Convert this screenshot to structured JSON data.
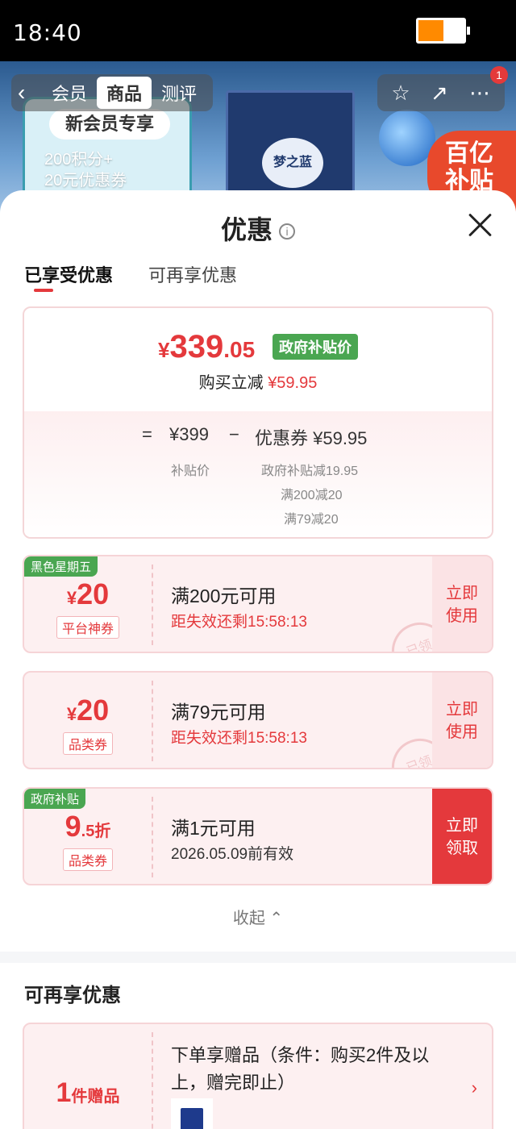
{
  "status_bar": {
    "time": "18:40",
    "battery_percent": 55,
    "battery_color": "#ff8a00"
  },
  "product_header": {
    "tabs": [
      "商品",
      "测评"
    ],
    "back_partial": "会员",
    "member_card": {
      "title": "新会员专享",
      "line1": "200积分+",
      "line2": "20元优惠券"
    },
    "product_logo": "梦之蓝",
    "subsidy_tag": [
      "百亿",
      "补贴"
    ],
    "notification_badge": "1"
  },
  "sheet": {
    "title": "优惠",
    "tabs": {
      "enjoyed": "已享受优惠",
      "available": "可再享优惠"
    },
    "summary": {
      "price_symbol": "¥",
      "price_int": "339",
      "price_dec": ".05",
      "price_tag": "政府补贴价",
      "discount_label": "购买立减",
      "discount_value": "¥59.95",
      "eq": "=",
      "base_price": "¥399",
      "base_label": "补贴价",
      "minus": "−",
      "coupon_label": "优惠券 ¥59.95",
      "details": [
        "政府补贴减19.95",
        "满200减20",
        "满79减20"
      ]
    },
    "coupons": [
      {
        "badge": "黑色星期五",
        "symbol": "¥",
        "amount": "20",
        "suffix": "",
        "type": "平台神券",
        "condition": "满200元可用",
        "expiry": "距失效还剩15:58:13",
        "button": [
          "立即",
          "使用"
        ],
        "claimed_stamp": "已领"
      },
      {
        "badge": "",
        "symbol": "¥",
        "amount": "20",
        "suffix": "",
        "type": "品类券",
        "condition": "满79元可用",
        "expiry": "距失效还剩15:58:13",
        "button": [
          "立即",
          "使用"
        ],
        "claimed_stamp": "已领"
      },
      {
        "badge": "政府补贴",
        "symbol": "",
        "amount": "9",
        "suffix": ".5折",
        "type": "品类券",
        "condition": "满1元可用",
        "expiry": "2026.05.09前有效",
        "button": [
          "立即",
          "领取"
        ],
        "claimed_stamp": ""
      }
    ],
    "collapse_label": "收起",
    "more_section_title": "可再享优惠",
    "gift": {
      "amount": "1",
      "suffix": "件赠品",
      "description": "下单享赠品（条件：购买2件及以上，赠完即止）"
    }
  },
  "colors": {
    "accent_red": "#e4393c",
    "green_tag": "#4aa651"
  }
}
